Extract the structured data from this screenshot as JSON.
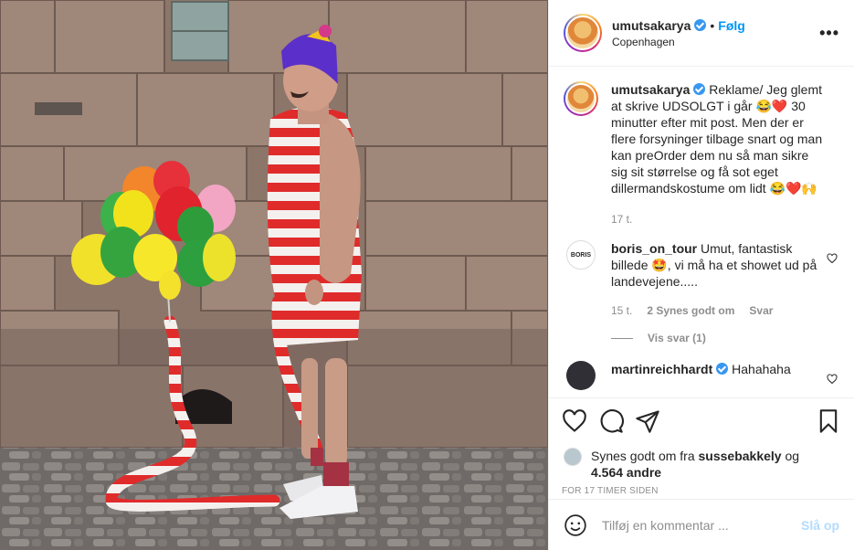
{
  "header": {
    "username": "umutsakarya",
    "separator": "•",
    "follow_label": "Følg",
    "location": "Copenhagen",
    "more_label": "•••"
  },
  "caption": {
    "username": "umutsakarya",
    "text": " Reklame/ Jeg glemt at skrive UDSOLGT i går 😂❤️ 30 minutter efter mit post. Men der er flere forsyninger tilbage snart og man kan preOrder dem nu så man sikre sig sit størrelse og få sot eget dillermandskostume om lidt 😂❤️🙌",
    "age": "17 t."
  },
  "comments": [
    {
      "username": "boris_on_tour",
      "text": " Umut, fantastisk billede 🤩, vi må ha et showet ud på landevejene.....",
      "age": "15 t.",
      "likes": "2 Synes godt om",
      "reply_label": "Svar",
      "avatar_text": "BORIS"
    },
    {
      "username": "martinreichhardt",
      "text": " Hahahaha"
    }
  ],
  "view_replies": "Vis svar (1)",
  "likes": {
    "prefix": "Synes godt om fra ",
    "user": "sussebakkely",
    "joiner": " og",
    "count": "4.564 andre"
  },
  "timestamp": "FOR 17 TIMER SIDEN",
  "add_comment": {
    "placeholder": "Tilføj en kommentar ...",
    "post_label": "Slå op"
  },
  "colors": {
    "link_blue": "#0095f6",
    "verified_blue": "#3897f0",
    "post_disabled": "#b3dbff",
    "stripe_red": "#e02b2b"
  }
}
